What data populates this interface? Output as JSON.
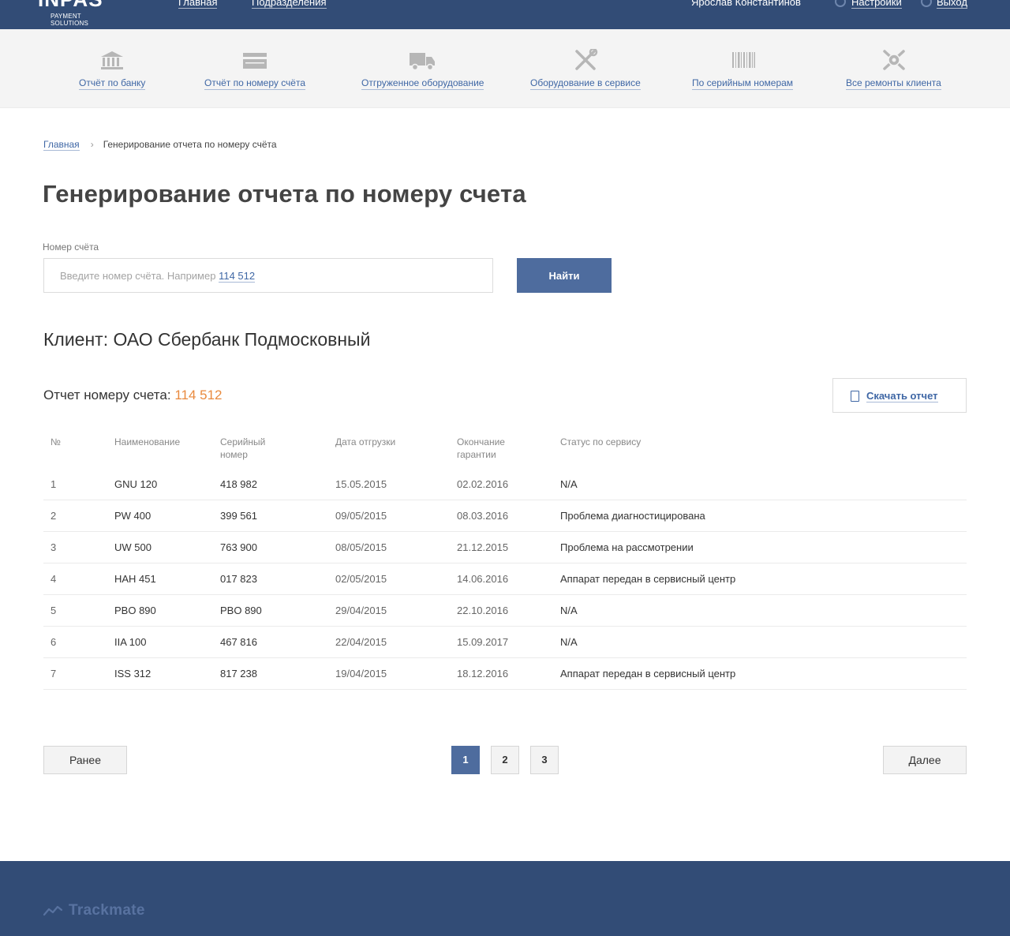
{
  "header": {
    "logo_mark": "INPAS",
    "logo_sub": "PAYMENT SOLUTIONS",
    "nav": [
      {
        "label": "Главная"
      },
      {
        "label": "Подразделения"
      }
    ],
    "user_name": "Ярослав Константинов",
    "settings_label": "Настройки",
    "logout_label": "Выход"
  },
  "toolbar": {
    "items": [
      {
        "label": "Отчёт по банку",
        "icon": "bank-icon"
      },
      {
        "label": "Отчёт по номеру счёта",
        "icon": "card-icon"
      },
      {
        "label": "Отгруженное оборудование",
        "icon": "truck-icon"
      },
      {
        "label": "Оборудование в сервисе",
        "icon": "tools-icon"
      },
      {
        "label": "По серийным номерам",
        "icon": "barcode-icon"
      },
      {
        "label": "Все ремонты клиента",
        "icon": "repairs-icon"
      }
    ]
  },
  "breadcrumb": {
    "home": "Главная",
    "current": "Генерирование отчета по номеру счёта"
  },
  "page_title": "Генерирование отчета по номеру счета",
  "search": {
    "label": "Номер счёта",
    "placeholder_prefix": "Введите номер счёта. Например",
    "placeholder_example": "114 512",
    "value": "",
    "button": "Найти"
  },
  "client": "Клиент: ОАО Сбербанк Подмосковный",
  "report": {
    "heading": "Отчет номеру счета:",
    "number": "114 512",
    "download_label": "Скачать отчет"
  },
  "table": {
    "headers": [
      "№",
      "Наименование",
      "Серийный номер",
      "Дата отгрузки",
      "Окончание гарантии",
      "Статус по сервису"
    ],
    "header_lines": [
      [
        "№"
      ],
      [
        "Наименование"
      ],
      [
        "Серийный",
        "номер"
      ],
      [
        "Дата отгрузки"
      ],
      [
        "Окончание",
        "гарантии"
      ],
      [
        "Статус по сервису"
      ]
    ],
    "rows": [
      [
        "1",
        "GNU 120",
        "418 982",
        "15.05.2015",
        "02.02.2016",
        "N/A"
      ],
      [
        "2",
        "PW 400",
        "399 561",
        "09/05/2015",
        "08.03.2016",
        "Проблема диагностицирована"
      ],
      [
        "3",
        "UW 500",
        "763 900",
        "08/05/2015",
        "21.12.2015",
        "Проблема на рассмотрении"
      ],
      [
        "4",
        "HAH 451",
        "017 823",
        "02/05/2015",
        "14.06.2016",
        "Аппарат передан в сервисный центр"
      ],
      [
        "5",
        "PBO 890",
        "PBO 890",
        "29/04/2015",
        "22.10.2016",
        "N/A"
      ],
      [
        "6",
        "IIA 100",
        "467 816",
        "22/04/2015",
        "15.09.2017",
        "N/A"
      ],
      [
        "7",
        "ISS 312",
        "817 238",
        "19/04/2015",
        "18.12.2016",
        "Аппарат передан в сервисный центр"
      ]
    ]
  },
  "pagination": {
    "prev": "Ранее",
    "next": "Далее",
    "pages": [
      "1",
      "2",
      "3"
    ],
    "current": "1"
  },
  "footer": {
    "brand": "Trackmate"
  },
  "colors": {
    "header_bg": "#324c76",
    "accent": "#4e6c9e",
    "link": "#3f67a5",
    "highlight": "#e98a3e"
  }
}
